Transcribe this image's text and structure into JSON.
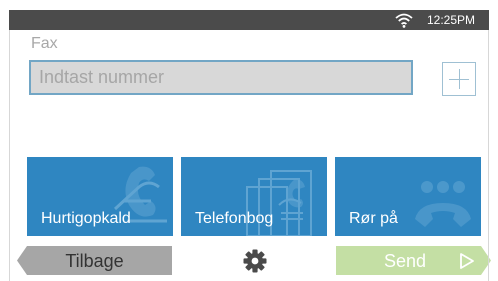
{
  "status_bar": {
    "time": "12:25PM",
    "wifi_icon": "wifi-icon"
  },
  "fax": {
    "label": "Fax",
    "input_value": "",
    "input_placeholder": "Indtast nummer",
    "add_icon": "plus-icon"
  },
  "tiles": [
    {
      "label": "Hurtigopkald",
      "icon": "speed-dial-phone-icon"
    },
    {
      "label": "Telefonbog",
      "icon": "phonebook-icon"
    },
    {
      "label": "Rør på",
      "icon": "on-hook-phone-icon"
    }
  ],
  "footer": {
    "back_label": "Tilbage",
    "settings_icon": "gear-icon",
    "send_label": "Send",
    "send_icon": "play-arrow-icon"
  },
  "colors": {
    "status_bar": "#4b4b4b",
    "tile": "#2f86c1",
    "input_border": "#72a6c5",
    "back_button": "#a6a6a6",
    "send_button": "#c4dfa4"
  }
}
